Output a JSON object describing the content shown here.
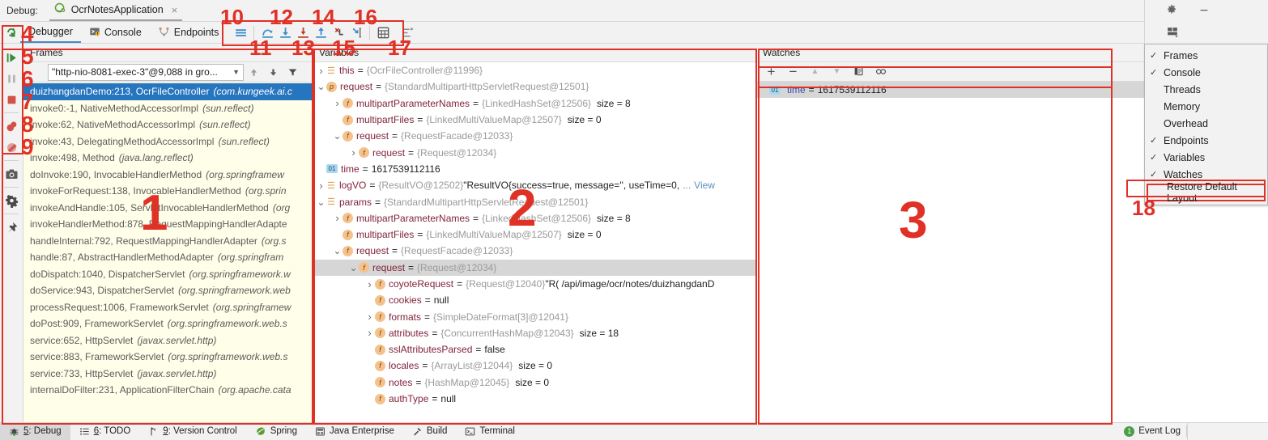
{
  "window": {
    "debug_label": "Debug:",
    "run_config": "OcrNotesApplication",
    "close_tab": "×",
    "gear_icon": "gear-icon",
    "minimize_icon": "minimize-icon",
    "layout_icon": "layout-settings-icon"
  },
  "tabs": [
    {
      "label": "Debugger",
      "icon": "debugger-icon",
      "selected": true
    },
    {
      "label": "Console",
      "icon": "console-icon",
      "selected": false
    },
    {
      "label": "Endpoints",
      "icon": "endpoints-icon",
      "selected": false
    }
  ],
  "toolbar": {
    "buttons": [
      {
        "name": "show-execution-point-icon",
        "glyph": "menu-lines"
      },
      {
        "name": "step-over-icon",
        "glyph": "step-over"
      },
      {
        "name": "step-into-icon",
        "glyph": "step-into"
      },
      {
        "name": "force-step-into-icon",
        "glyph": "force-step-into"
      },
      {
        "name": "step-out-icon",
        "glyph": "step-out"
      },
      {
        "name": "drop-frame-icon",
        "glyph": "drop-frame"
      },
      {
        "name": "run-to-cursor-icon",
        "glyph": "run-to-cursor"
      },
      {
        "name": "evaluate-expression-icon",
        "glyph": "evaluate"
      },
      {
        "name": "settings-icon",
        "glyph": "extra"
      }
    ]
  },
  "sidebar": {
    "buttons": [
      {
        "name": "rerun-icon",
        "glyph": "rerun"
      },
      {
        "name": "resume-program-icon",
        "glyph": "resume"
      },
      {
        "name": "pause-program-icon",
        "glyph": "pause"
      },
      {
        "name": "stop-icon",
        "glyph": "stop"
      },
      {
        "name": "view-breakpoints-icon",
        "glyph": "breakpoints"
      },
      {
        "name": "mute-breakpoints-icon",
        "glyph": "mute"
      },
      {
        "name": "screenshot-icon",
        "glyph": "camera"
      },
      {
        "name": "settings-icon",
        "glyph": "gear"
      },
      {
        "name": "pin-tab-icon",
        "glyph": "pin"
      }
    ]
  },
  "frames": {
    "header": "Frames",
    "thread": "\"http-nio-8081-exec-3\"@9,088 in gro...",
    "dropdown_icon": "chevron-down-icon",
    "up_icon": "arrow-up-icon",
    "down_icon": "arrow-down-icon",
    "filter_icon": "filter-icon",
    "rows": [
      {
        "method": "duizhangdanDemo:213, OcrFileController",
        "pkg": "(com.kungeek.ai.c",
        "selected": true
      },
      {
        "method": "invoke0:-1, NativeMethodAccessorImpl",
        "pkg": "(sun.reflect)",
        "selected": false
      },
      {
        "method": "invoke:62, NativeMethodAccessorImpl",
        "pkg": "(sun.reflect)",
        "selected": false
      },
      {
        "method": "invoke:43, DelegatingMethodAccessorImpl",
        "pkg": "(sun.reflect)",
        "selected": false
      },
      {
        "method": "invoke:498, Method",
        "pkg": "(java.lang.reflect)",
        "selected": false
      },
      {
        "method": "doInvoke:190, InvocableHandlerMethod",
        "pkg": "(org.springframew",
        "selected": false
      },
      {
        "method": "invokeForRequest:138, InvocableHandlerMethod",
        "pkg": "(org.sprin",
        "selected": false
      },
      {
        "method": "invokeAndHandle:105, ServletInvocableHandlerMethod",
        "pkg": "(org",
        "selected": false
      },
      {
        "method": "invokeHandlerMethod:878, RequestMappingHandlerAdapte",
        "pkg": "",
        "selected": false
      },
      {
        "method": "handleInternal:792, RequestMappingHandlerAdapter",
        "pkg": "(org.s",
        "selected": false
      },
      {
        "method": "handle:87, AbstractHandlerMethodAdapter",
        "pkg": "(org.springfram",
        "selected": false
      },
      {
        "method": "doDispatch:1040, DispatcherServlet",
        "pkg": "(org.springframework.w",
        "selected": false
      },
      {
        "method": "doService:943, DispatcherServlet",
        "pkg": "(org.springframework.web",
        "selected": false
      },
      {
        "method": "processRequest:1006, FrameworkServlet",
        "pkg": "(org.springframew",
        "selected": false
      },
      {
        "method": "doPost:909, FrameworkServlet",
        "pkg": "(org.springframework.web.s",
        "selected": false
      },
      {
        "method": "service:652, HttpServlet",
        "pkg": "(javax.servlet.http)",
        "selected": false
      },
      {
        "method": "service:883, FrameworkServlet",
        "pkg": "(org.springframework.web.s",
        "selected": false
      },
      {
        "method": "service:733, HttpServlet",
        "pkg": "(javax.servlet.http)",
        "selected": false
      },
      {
        "method": "internalDoFilter:231, ApplicationFilterChain",
        "pkg": "(org.apache.cata",
        "selected": false
      }
    ]
  },
  "variables": {
    "header": "Variables",
    "rows": [
      {
        "indent": 0,
        "arrow": "collapsed",
        "badge": "obj",
        "name": "this",
        "value": "{OcrFileController@11996}",
        "size": "",
        "selected": false
      },
      {
        "indent": 0,
        "arrow": "expanded",
        "badge": "p",
        "name": "request",
        "value": "{StandardMultipartHttpServletRequest@12501}",
        "size": "",
        "selected": false
      },
      {
        "indent": 1,
        "arrow": "collapsed",
        "badge": "f",
        "name": "multipartParameterNames",
        "value": "{LinkedHashSet@12506}",
        "size": "size = 8",
        "selected": false
      },
      {
        "indent": 1,
        "arrow": "none",
        "badge": "f",
        "name": "multipartFiles",
        "value": "{LinkedMultiValueMap@12507}",
        "size": "size = 0",
        "selected": false
      },
      {
        "indent": 1,
        "arrow": "expanded",
        "badge": "f",
        "name": "request",
        "value": "{RequestFacade@12033}",
        "size": "",
        "selected": false
      },
      {
        "indent": 2,
        "arrow": "collapsed",
        "badge": "f",
        "name": "request",
        "value": "{Request@12034}",
        "size": "",
        "selected": false
      },
      {
        "indent": 0,
        "arrow": "none",
        "badge": "num",
        "name": "time",
        "value": "1617539112116",
        "size": "",
        "plain": true,
        "selected": false
      },
      {
        "indent": 0,
        "arrow": "collapsed",
        "badge": "obj",
        "name": "logVO",
        "value": "{ResultVO@12502}",
        "str": "\"ResultVO{success=true, message='', useTime=0,",
        "ellipsis": "...",
        "link": "View",
        "size": "",
        "selected": false
      },
      {
        "indent": 0,
        "arrow": "expanded",
        "badge": "obj",
        "name": "params",
        "value": "{StandardMultipartHttpServletRequest@12501}",
        "size": "",
        "selected": false
      },
      {
        "indent": 1,
        "arrow": "collapsed",
        "badge": "f",
        "name": "multipartParameterNames",
        "value": "{LinkedHashSet@12506}",
        "size": "size = 8",
        "selected": false
      },
      {
        "indent": 1,
        "arrow": "none",
        "badge": "f",
        "name": "multipartFiles",
        "value": "{LinkedMultiValueMap@12507}",
        "size": "size = 0",
        "selected": false
      },
      {
        "indent": 1,
        "arrow": "expanded",
        "badge": "f",
        "name": "request",
        "value": "{RequestFacade@12033}",
        "size": "",
        "selected": false
      },
      {
        "indent": 2,
        "arrow": "expanded",
        "badge": "f",
        "name": "request",
        "value": "{Request@12034}",
        "size": "",
        "selected": true
      },
      {
        "indent": 3,
        "arrow": "collapsed",
        "badge": "f",
        "name": "coyoteRequest",
        "value": "{Request@12040}",
        "str": "\"R( /api/image/ocr/notes/duizhangdanD",
        "size": "",
        "selected": false
      },
      {
        "indent": 3,
        "arrow": "none",
        "badge": "f",
        "name": "cookies",
        "value": "null",
        "plainval": true,
        "size": "",
        "selected": false
      },
      {
        "indent": 3,
        "arrow": "collapsed",
        "badge": "f",
        "name": "formats",
        "value": "{SimpleDateFormat[3]@12041}",
        "size": "",
        "selected": false
      },
      {
        "indent": 3,
        "arrow": "collapsed",
        "badge": "f",
        "name": "attributes",
        "value": "{ConcurrentHashMap@12043}",
        "size": "size = 18",
        "selected": false
      },
      {
        "indent": 3,
        "arrow": "none",
        "badge": "f",
        "name": "sslAttributesParsed",
        "value": "false",
        "plainval": true,
        "size": "",
        "selected": false
      },
      {
        "indent": 3,
        "arrow": "none",
        "badge": "f",
        "name": "locales",
        "value": "{ArrayList@12044}",
        "size": "size = 0",
        "selected": false
      },
      {
        "indent": 3,
        "arrow": "none",
        "badge": "f",
        "name": "notes",
        "value": "{HashMap@12045}",
        "size": "size = 0",
        "selected": false
      },
      {
        "indent": 3,
        "arrow": "none",
        "badge": "f",
        "name": "authType",
        "value": "null",
        "plainval": true,
        "size": "",
        "selected": false
      }
    ]
  },
  "watches": {
    "header": "Watches",
    "toolbar": [
      {
        "name": "add-watch-button",
        "glyph": "+"
      },
      {
        "name": "remove-watch-button",
        "glyph": "−"
      },
      {
        "name": "move-watch-up-button",
        "glyph": "▲"
      },
      {
        "name": "move-watch-down-button",
        "glyph": "▼"
      },
      {
        "name": "copy-watch-button",
        "glyph": "copy"
      },
      {
        "name": "inspect-watch-button",
        "glyph": "oo"
      }
    ],
    "rows": [
      {
        "badge": "01",
        "name": "time",
        "eq": "=",
        "value": "1617539112116"
      }
    ]
  },
  "menu": {
    "items": [
      {
        "label": "Frames",
        "checked": true,
        "boxed": false
      },
      {
        "label": "Console",
        "checked": true,
        "boxed": false
      },
      {
        "label": "Threads",
        "checked": false,
        "boxed": false
      },
      {
        "label": "Memory",
        "checked": false,
        "boxed": false
      },
      {
        "label": "Overhead",
        "checked": false,
        "boxed": false
      },
      {
        "label": "Endpoints",
        "checked": true,
        "boxed": false
      },
      {
        "label": "Variables",
        "checked": true,
        "boxed": false
      },
      {
        "label": "Watches",
        "checked": true,
        "boxed": false
      },
      {
        "label": "Restore Default Layout",
        "checked": false,
        "boxed": true
      }
    ]
  },
  "status": {
    "items": [
      {
        "num": "5",
        "label": ": Debug",
        "icon": "debug-icon",
        "active": true
      },
      {
        "num": "6",
        "label": ": TODO",
        "icon": "todo-icon",
        "active": false
      },
      {
        "num": "9",
        "label": ": Version Control",
        "icon": "vcs-icon",
        "active": false
      },
      {
        "num": "",
        "label": "Spring",
        "icon": "spring-icon",
        "active": false
      },
      {
        "num": "",
        "label": "Java Enterprise",
        "icon": "java-enterprise-icon",
        "active": false
      },
      {
        "num": "",
        "label": "Build",
        "icon": "build-icon",
        "active": false
      },
      {
        "num": "",
        "label": "Terminal",
        "icon": "terminal-icon",
        "active": false
      }
    ],
    "event_log": {
      "count": "1",
      "label": "Event Log"
    }
  },
  "annotations": {
    "numbers": [
      "1",
      "2",
      "3",
      "4",
      "5",
      "6",
      "7",
      "8",
      "9",
      "10",
      "11",
      "12",
      "13",
      "14",
      "15",
      "16",
      "17",
      "18"
    ]
  },
  "colors": {
    "accent_red": "#e03127",
    "selection_blue": "#2675bf",
    "frames_bg": "#fffee8",
    "var_name": "#80233b",
    "link": "#5c8fbf"
  }
}
